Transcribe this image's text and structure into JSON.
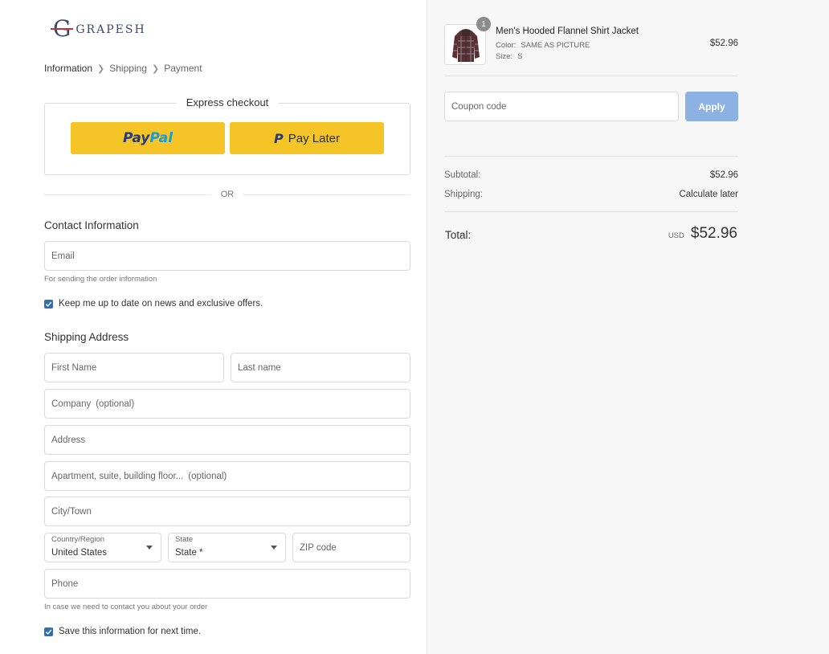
{
  "brand": {
    "logo_mark": "G",
    "name": "GRAPESH"
  },
  "breadcrumb": [
    {
      "label": "Information",
      "active": true
    },
    {
      "label": "Shipping",
      "active": false
    },
    {
      "label": "Payment",
      "active": false
    }
  ],
  "express": {
    "title": "Express checkout",
    "paypal_a": "Pay",
    "paypal_b": "Pal",
    "paylater_icon": "P",
    "paylater_label": "Pay Later",
    "or_label": "OR"
  },
  "contact": {
    "title": "Contact Information",
    "email_placeholder": "Email",
    "email_helper": "For sending the order information",
    "newsletter_label": "Keep me up to date on news and exclusive offers.",
    "newsletter_checked": true
  },
  "shipping": {
    "title": "Shipping Address",
    "first_name": "First Name",
    "last_name": "Last name",
    "company": "Company",
    "company_opt": "(optional)",
    "address": "Address",
    "apartment": "Apartment, suite, building floor...",
    "apartment_opt": "(optional)",
    "city": "City/Town",
    "country_label": "Country/Region",
    "country_value": "United States",
    "state_label": "State",
    "state_value": "State *",
    "zip": "ZIP code",
    "phone": "Phone",
    "phone_helper": "In case we need to contact you about your order",
    "save_label": "Save this information for next time.",
    "save_checked": true
  },
  "cart": {
    "item": {
      "quantity_badge": "1",
      "title": "Men's Hooded Flannel Shirt Jacket",
      "color_key": "Color:",
      "color_value": "SAME AS PICTURE",
      "size_key": "Size:",
      "size_value": "S",
      "price": "$52.96",
      "image_icon": "flannel-jacket-image"
    },
    "coupon_placeholder": "Coupon code",
    "apply_label": "Apply",
    "subtotal_label": "Subtotal:",
    "subtotal_value": "$52.96",
    "shipping_label": "Shipping:",
    "shipping_value": "Calculate later",
    "total_label": "Total:",
    "total_currency": "USD",
    "total_value": "$52.96"
  },
  "colors": {
    "paypal_yellow": "#f5c427",
    "paypal_dark_blue": "#253b80",
    "paypal_light_blue": "#179bd7",
    "apply_blue": "#8cb2e3",
    "checkbox_blue": "#2f6fb4"
  }
}
